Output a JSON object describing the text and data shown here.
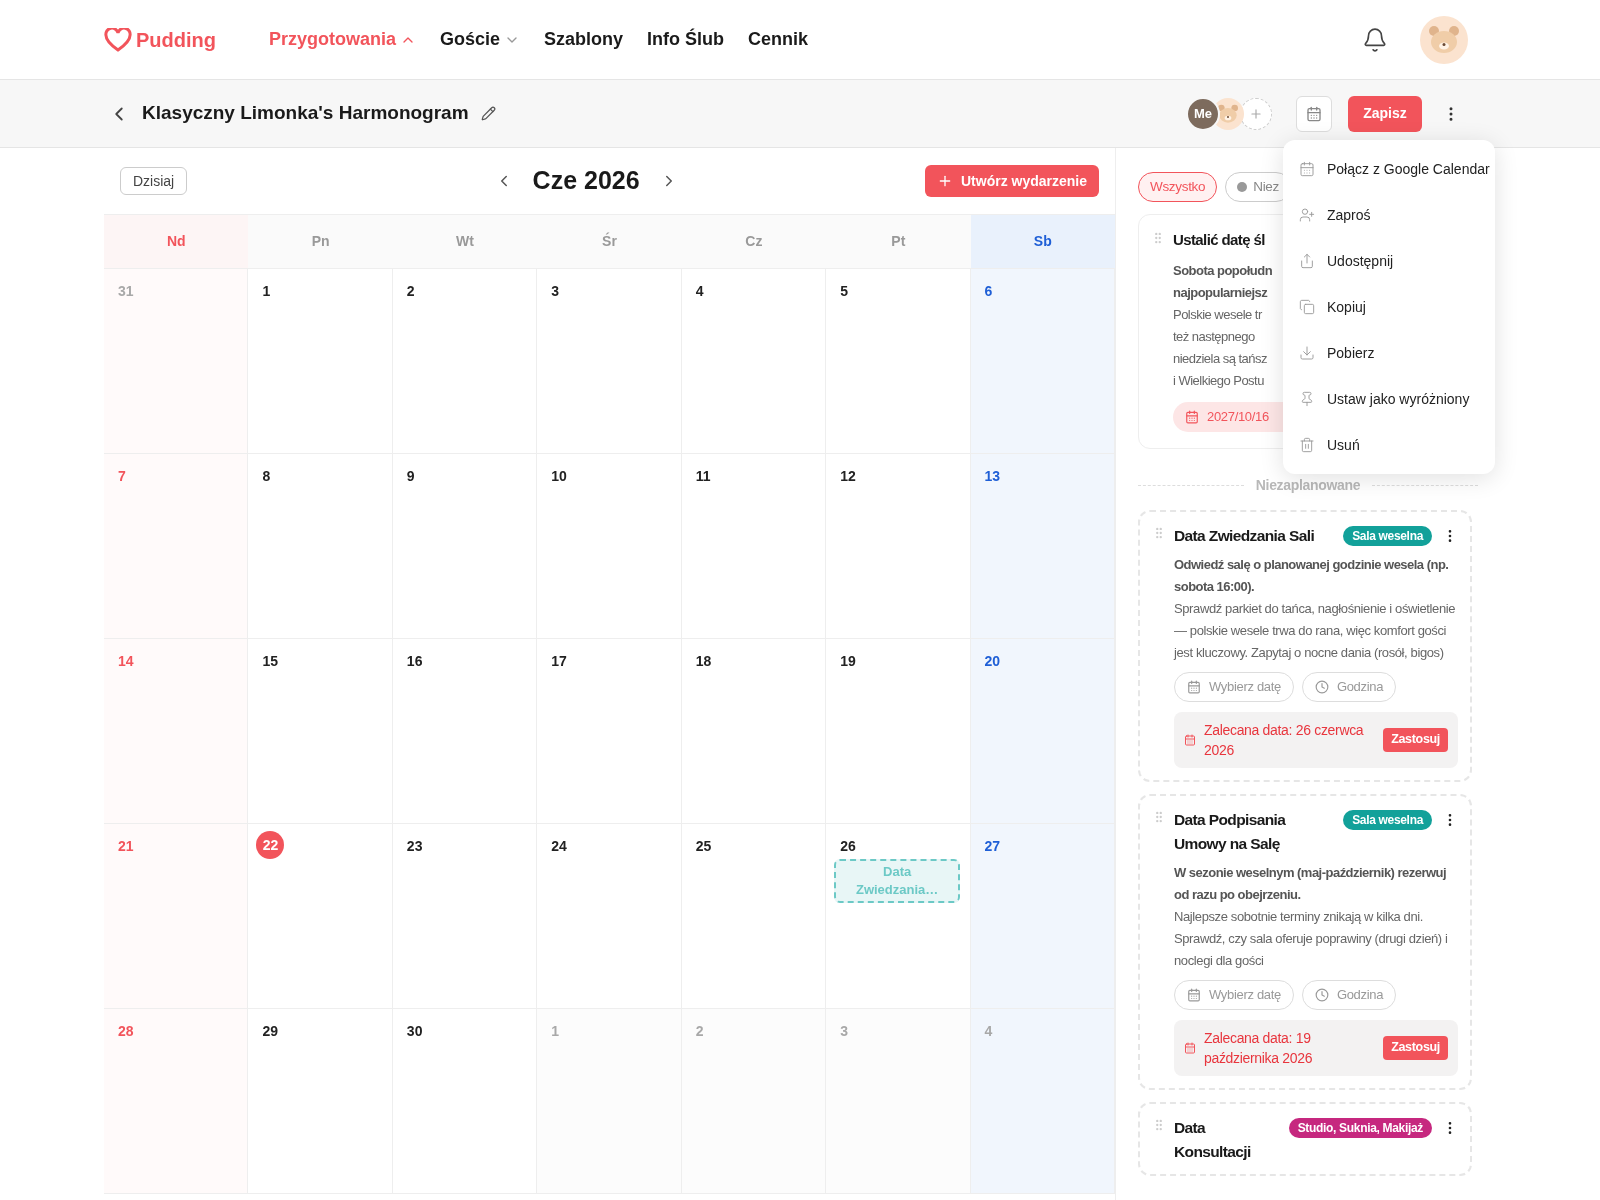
{
  "header": {
    "logo": "Pudding",
    "nav": [
      {
        "label": "Przygotowania",
        "selected": true,
        "has_menu": true
      },
      {
        "label": "Goście",
        "selected": false,
        "has_menu": true
      },
      {
        "label": "Szablony",
        "selected": false,
        "has_menu": false
      },
      {
        "label": "Info Ślub",
        "selected": false,
        "has_menu": false
      },
      {
        "label": "Cennik",
        "selected": false,
        "has_menu": false
      }
    ]
  },
  "toolbar": {
    "title": "Klasyczny Limonka's Harmonogram",
    "collaborators": [
      {
        "kind": "initials",
        "label": "Me"
      },
      {
        "kind": "avatar"
      }
    ],
    "save_button": "Zapisz"
  },
  "calendar": {
    "today_button": "Dzisiaj",
    "month": "Cze 2026",
    "create_button": "Utwórz wydarzenie",
    "weekdays": [
      {
        "label": "Nd",
        "kind": "sunday"
      },
      {
        "label": "Pn",
        "kind": "weekday"
      },
      {
        "label": "Wt",
        "kind": "weekday"
      },
      {
        "label": "Śr",
        "kind": "weekday"
      },
      {
        "label": "Cz",
        "kind": "weekday"
      },
      {
        "label": "Pt",
        "kind": "weekday"
      },
      {
        "label": "Sb",
        "kind": "saturday"
      }
    ],
    "weeks": [
      [
        {
          "day": "31",
          "muted": true,
          "today": false
        },
        {
          "day": "1",
          "muted": false,
          "today": false
        },
        {
          "day": "2",
          "muted": false,
          "today": false
        },
        {
          "day": "3",
          "muted": false,
          "today": false
        },
        {
          "day": "4",
          "muted": false,
          "today": false
        },
        {
          "day": "5",
          "muted": false,
          "today": false
        },
        {
          "day": "6",
          "muted": false,
          "today": false
        }
      ],
      [
        {
          "day": "7",
          "muted": false,
          "today": false
        },
        {
          "day": "8",
          "muted": false,
          "today": false
        },
        {
          "day": "9",
          "muted": false,
          "today": false
        },
        {
          "day": "10",
          "muted": false,
          "today": false
        },
        {
          "day": "11",
          "muted": false,
          "today": false
        },
        {
          "day": "12",
          "muted": false,
          "today": false
        },
        {
          "day": "13",
          "muted": false,
          "today": false
        }
      ],
      [
        {
          "day": "14",
          "muted": false,
          "today": false
        },
        {
          "day": "15",
          "muted": false,
          "today": false
        },
        {
          "day": "16",
          "muted": false,
          "today": false
        },
        {
          "day": "17",
          "muted": false,
          "today": false
        },
        {
          "day": "18",
          "muted": false,
          "today": false
        },
        {
          "day": "19",
          "muted": false,
          "today": false
        },
        {
          "day": "20",
          "muted": false,
          "today": false
        }
      ],
      [
        {
          "day": "21",
          "muted": false,
          "today": false
        },
        {
          "day": "22",
          "muted": false,
          "today": true
        },
        {
          "day": "23",
          "muted": false,
          "today": false
        },
        {
          "day": "24",
          "muted": false,
          "today": false
        },
        {
          "day": "25",
          "muted": false,
          "today": false
        },
        {
          "day": "26",
          "muted": false,
          "today": false,
          "events": [
            {
              "title": "Data Zwiedzania…",
              "color": "#6cc9c6"
            }
          ]
        },
        {
          "day": "27",
          "muted": false,
          "today": false
        }
      ],
      [
        {
          "day": "28",
          "muted": false,
          "today": false
        },
        {
          "day": "29",
          "muted": false,
          "today": false
        },
        {
          "day": "30",
          "muted": false,
          "today": false
        },
        {
          "day": "1",
          "muted": true,
          "today": false
        },
        {
          "day": "2",
          "muted": true,
          "today": false
        },
        {
          "day": "3",
          "muted": true,
          "today": false
        },
        {
          "day": "4",
          "muted": true,
          "today": false
        }
      ]
    ]
  },
  "panel": {
    "filters": [
      {
        "label": "Wszystko",
        "kind": "all",
        "selected": true
      },
      {
        "label": "Niez",
        "kind": "dot",
        "selected": false
      }
    ],
    "scheduled": [
      {
        "title": "Ustalić datę śl",
        "lines": [
          {
            "text": "Sobota popołudn",
            "bold": true
          },
          {
            "text": "najpopularniejsz",
            "bold": true
          },
          {
            "text": "Polskie wesele tr",
            "bold": false
          },
          {
            "text": "też następnego",
            "bold": false
          },
          {
            "text": "niedziela są tańsz",
            "bold": false
          },
          {
            "text": "i Wielkiego Postu",
            "bold": false
          }
        ],
        "date": "2027/10/16"
      }
    ],
    "divider": "Niezaplanowane",
    "unscheduled": [
      {
        "title": "Data Zwiedzania Sali",
        "tag": {
          "label": "Sala weselna",
          "color": "#12a19a"
        },
        "summary": "Odwiedź salę o planowanej godzinie wesela (np. sobota 16:00).",
        "details": "Sprawdź parkiet do tańca, nagłośnienie i oświetlenie — polskie wesele trwa do rana, więc komfort gości jest kluczowy. Zapytaj o nocne dania (rosół, bigos)",
        "date_placeholder": "Wybierz datę",
        "time_placeholder": "Godzina",
        "suggestion": "Zalecana data: 26 czerwca 2026",
        "apply": "Zastosuj"
      },
      {
        "title": "Data Podpisania Umowy na Salę",
        "tag": {
          "label": "Sala weselna",
          "color": "#12a19a"
        },
        "summary": "W sezonie weselnym (maj-październik) rezerwuj od razu po obejrzeniu.",
        "details": "Najlepsze sobotnie terminy znikają w kilka dni. Sprawdź, czy sala oferuje poprawiny (drugi dzień) i noclegi dla gości",
        "date_placeholder": "Wybierz datę",
        "time_placeholder": "Godzina",
        "suggestion": "Zalecana data: 19 października 2026",
        "apply": "Zastosuj"
      },
      {
        "title": "Data Konsultacji",
        "tag": {
          "label": "Studio, Suknia, Makijaż",
          "color": "#c6287f"
        }
      }
    ]
  },
  "menu": {
    "items": [
      {
        "label": "Połącz z Google Calendar",
        "kind": "calendar"
      },
      {
        "label": "Zaproś",
        "kind": "invite"
      },
      {
        "label": "Udostępnij",
        "kind": "share"
      },
      {
        "label": "Kopiuj",
        "kind": "copy"
      },
      {
        "label": "Pobierz",
        "kind": "download"
      },
      {
        "label": "Ustaw jako wyróżniony",
        "kind": "pin"
      },
      {
        "label": "Usuń",
        "kind": "delete"
      }
    ]
  }
}
